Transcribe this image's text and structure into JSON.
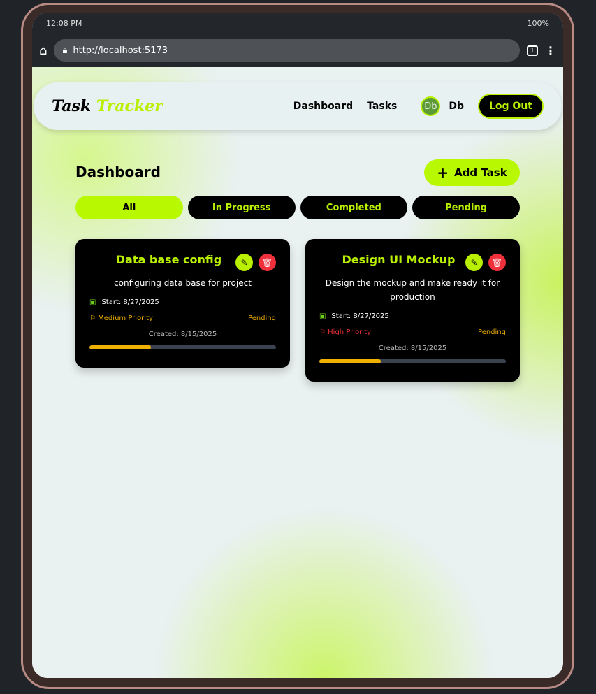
{
  "status_bar": {
    "time": "12:08 PM",
    "battery": "100%"
  },
  "browser": {
    "url": "http://localhost:5173",
    "tab_count": "1"
  },
  "nav": {
    "logo_part1": "Task",
    "logo_part2": "Tracker",
    "links": [
      "Dashboard",
      "Tasks"
    ],
    "avatar": "Db",
    "username": "Db",
    "logout": "Log Out"
  },
  "main": {
    "title": "Dashboard",
    "add_task": "Add Task",
    "filters": [
      "All",
      "In Progress",
      "Completed",
      "Pending"
    ],
    "active_filter": "All"
  },
  "tasks": [
    {
      "title": "Data base config",
      "description": "configuring data base for project",
      "start": "Start: 8/27/2025",
      "priority": "Medium Priority",
      "priority_color": "#f0b000",
      "status": "Pending",
      "created": "Created: 8/15/2025",
      "progress": 33
    },
    {
      "title": "Design UI Mockup",
      "description": "Design the mockup and make ready it for production",
      "start": "Start: 8/27/2025",
      "priority": "High Priority",
      "priority_color": "#f0303a",
      "status": "Pending",
      "created": "Created: 8/15/2025",
      "progress": 33
    }
  ],
  "colors": {
    "accent": "#b8f800",
    "danger": "#f0303a",
    "warning": "#f0b000"
  }
}
